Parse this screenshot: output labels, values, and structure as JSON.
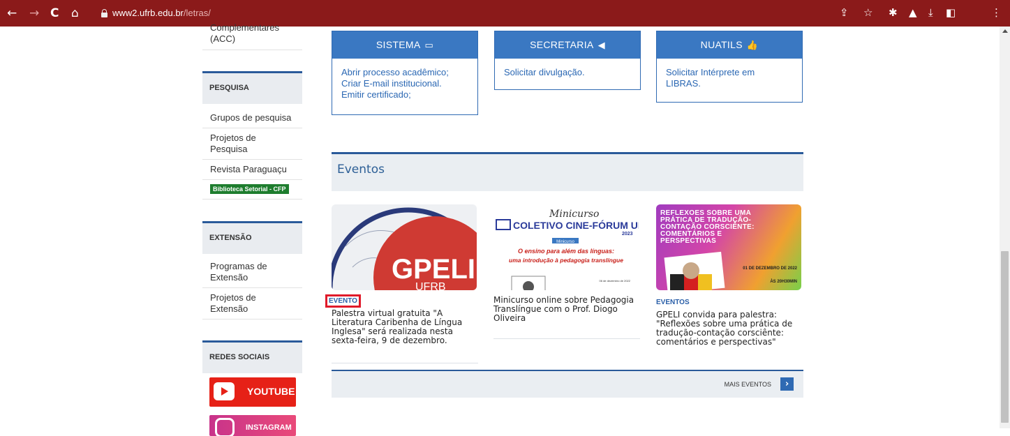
{
  "browser": {
    "url_domain": "www2.ufrb.edu.br",
    "url_path": "/letras/"
  },
  "sidebar": {
    "acc_label": "Complementares (ACC)",
    "pesquisa_header": "PESQUISA",
    "pesquisa_items": [
      "Grupos de pesquisa",
      "Projetos de Pesquisa",
      "Revista Paraguaçu"
    ],
    "biblioteca_badge": "Biblioteca Setorial - CFP",
    "extensao_header": "EXTENSÃO",
    "extensao_items": [
      "Programas de Extensão",
      "Projetos de Extensão"
    ],
    "redes_header": "REDES SOCIAIS",
    "youtube_label": "YOUTUBE",
    "instagram_label": "INSTAGRAM"
  },
  "services": [
    {
      "title": "SISTEMA",
      "icon": "laptop-icon",
      "lines": [
        "Abrir processo acadêmico;",
        "Criar E-mail institucional.",
        "Emitir certificado;"
      ]
    },
    {
      "title": "SECRETARIA",
      "icon": "megaphone-icon",
      "lines": [
        "Solicitar divulgação."
      ]
    },
    {
      "title": "NUATILS",
      "icon": "thumbs-up-icon",
      "lines": [
        "Solicitar Intérprete em",
        "LIBRAS."
      ]
    }
  ],
  "events": {
    "section_title": "Eventos",
    "items": [
      {
        "tag": "EVENTO",
        "title": "Palestra virtual gratuita \"A Literatura Caribenha de Língua Inglesa\" será realizada nesta sexta-feira, 9 de dezembro.",
        "image_text": "GPELI",
        "image_subtext": "UFRB"
      },
      {
        "tag": "",
        "title": "Minicurso online sobre Pedagogia Translíngue com o Prof. Diogo Oliveira",
        "image_line1": "Minicurso",
        "image_line2": "O ensino para além das línguas:",
        "image_line3": "uma introdução à pedagogia translíngue",
        "image_logo": "COLETIVO CINE-FÓRUM UEMS",
        "image_year": "2023",
        "image_overlay": "Minicurso",
        "image_date": "06 de dezembro de 2022"
      },
      {
        "tag": "EVENTOS",
        "title": "GPELI convida para palestra: \"Reflexões sobre uma prática de tradução-contação corsciênte: comentários e perspectivas\"",
        "image_heading": "REFLEXÕES SOBRE UMA PRÁTICA DE TRADUÇÃO-CONTAÇÃO CORSCIÊNTE: COMENTÁRIOS E PERSPECTIVAS",
        "image_date": "01 DE DEZEMBRO DE 2022",
        "image_time": "ÀS 20H30MIN"
      }
    ],
    "more_label": "MAIS EVENTOS",
    "more_arrow": "›"
  },
  "colors": {
    "browser_bar": "#8b1a1a",
    "accent_blue": "#3a78c2",
    "link_blue": "#2a67b3",
    "highlight_red": "#e01a2a",
    "library_green": "#1e7d2e"
  }
}
